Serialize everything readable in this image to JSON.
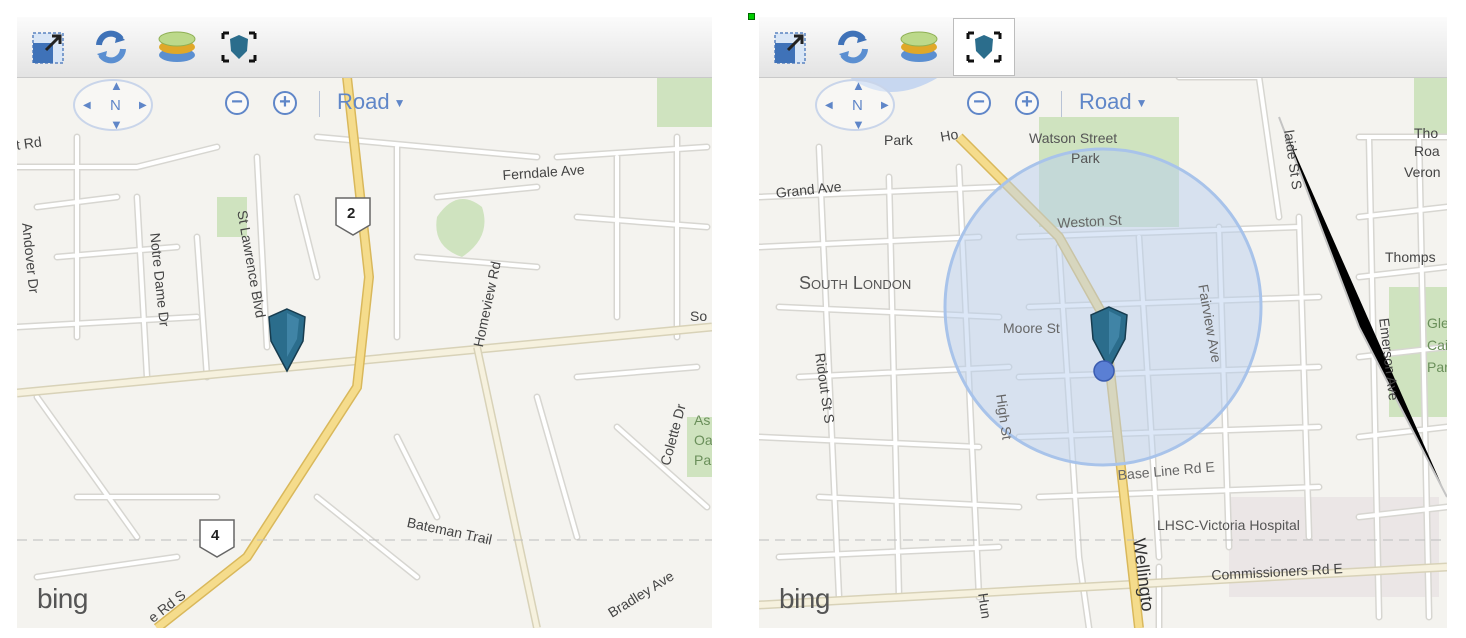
{
  "left_panel": {
    "toolbar": {
      "buttons": [
        {
          "name": "expand-icon"
        },
        {
          "name": "refresh-icon"
        },
        {
          "name": "layers-icon"
        },
        {
          "name": "locate-me-icon",
          "active": false
        }
      ]
    },
    "nav": {
      "compass_n": "N",
      "zoom_out": "−",
      "zoom_in": "+",
      "map_style": "Road"
    },
    "labels": {
      "l1": "t Rd",
      "l2": "Ferndale Ave",
      "l3": "Andover Dr",
      "l4": "Notre Dame Dr",
      "l5": "St Lawrence Blvd",
      "l6": "Homeview Rd",
      "l7": "So",
      "l8": "Colette Dr",
      "l9": "As",
      "l10": "Oa",
      "l11": "Pa",
      "l12": "Bateman Trail",
      "l13": "Bradley Ave",
      "l14": "e Rd S",
      "shield_2": "2",
      "shield_4": "4"
    },
    "brand": "bing"
  },
  "right_panel": {
    "toolbar": {
      "buttons": [
        {
          "name": "expand-icon"
        },
        {
          "name": "refresh-icon"
        },
        {
          "name": "layers-icon"
        },
        {
          "name": "locate-me-icon",
          "active": true
        }
      ]
    },
    "nav": {
      "compass_n": "N",
      "zoom_out": "−",
      "zoom_in": "+",
      "map_style": "Road"
    },
    "labels": {
      "r1": "Park",
      "r2": "Watson Street",
      "r3": "Park",
      "r4": "laide St S",
      "r5": "Tho",
      "r6": "Roa",
      "r7": "Veron",
      "r8": "Grand Ave",
      "r9": "Weston St",
      "r10": "South London",
      "r11": "Thomps",
      "r12": "Moore St",
      "r13": "Fairview Ave",
      "r14": "Gle",
      "r15": "Cai",
      "r16": "Par",
      "r17": "Emerson Ave",
      "r18": "Ridout St S",
      "r19": "High St",
      "r20": "Base Line Rd E",
      "r21": "LHSC-Victoria Hospital",
      "r22": "Commissioners Rd E",
      "r23": "Wellingto",
      "r24": "Hun",
      "r25": "Ho"
    },
    "brand": "bing"
  },
  "colors": {
    "map_bg": "#f4f3ef",
    "street": "#ffffff",
    "street_edge": "#d7d6d1",
    "highway": "#f5dc8c",
    "park": "#cfe3bf",
    "accent": "#5f86c8",
    "pin": "#2b6d8c",
    "accuracy_circle": "#b9cff0"
  }
}
